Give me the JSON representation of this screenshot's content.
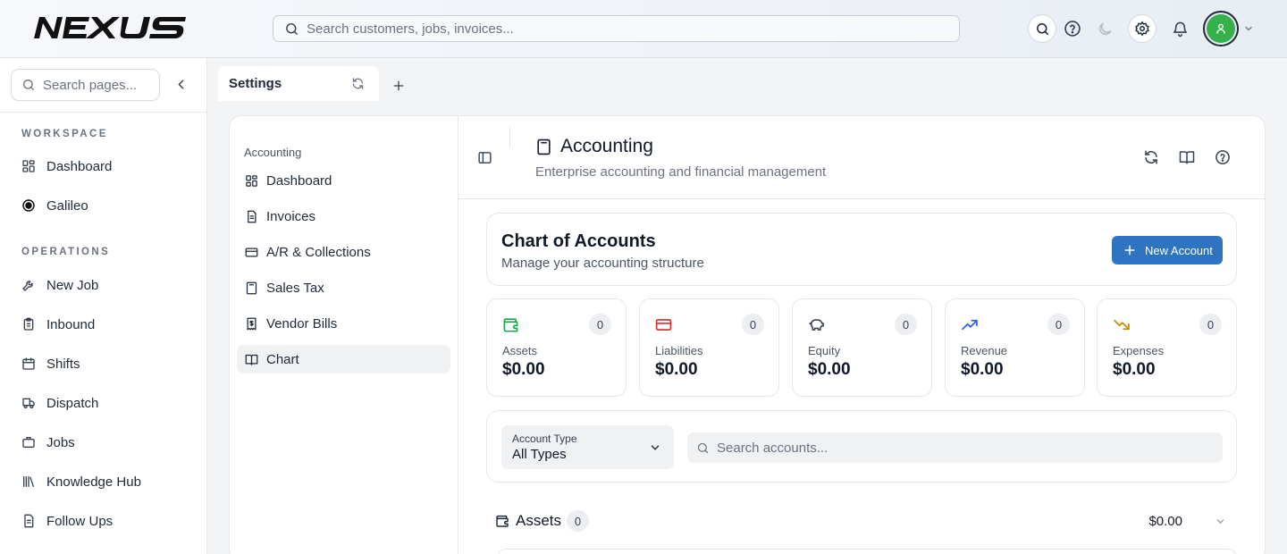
{
  "brand": {
    "logo_text": "NEXUS"
  },
  "top": {
    "search_placeholder": "Search customers, jobs, invoices..."
  },
  "sidebar": {
    "search_placeholder": "Search pages...",
    "sections": [
      {
        "title": "WORKSPACE",
        "items": [
          {
            "label": "Dashboard",
            "icon": "grid-icon"
          },
          {
            "label": "Galileo",
            "icon": "galileo-icon"
          }
        ]
      },
      {
        "title": "OPERATIONS",
        "items": [
          {
            "label": "New Job",
            "icon": "wrench-icon"
          },
          {
            "label": "Inbound",
            "icon": "clipboard-icon"
          },
          {
            "label": "Shifts",
            "icon": "calendar-icon"
          },
          {
            "label": "Dispatch",
            "icon": "truck-icon"
          },
          {
            "label": "Jobs",
            "icon": "briefcase-icon"
          },
          {
            "label": "Knowledge Hub",
            "icon": "library-icon"
          },
          {
            "label": "Follow Ups",
            "icon": "document-icon"
          }
        ]
      }
    ]
  },
  "tabs": [
    {
      "label": "Settings"
    }
  ],
  "accounting_menu": {
    "heading": "Accounting",
    "items": [
      {
        "label": "Dashboard",
        "icon": "grid-icon"
      },
      {
        "label": "Invoices",
        "icon": "document-icon"
      },
      {
        "label": "A/R & Collections",
        "icon": "credit-card-icon"
      },
      {
        "label": "Sales Tax",
        "icon": "calculator-icon"
      },
      {
        "label": "Vendor Bills",
        "icon": "receipt-icon"
      },
      {
        "label": "Chart",
        "icon": "book-icon",
        "active": true
      }
    ]
  },
  "module": {
    "title": "Accounting",
    "subtitle": "Enterprise accounting and financial management"
  },
  "chart_of_accounts": {
    "title": "Chart of Accounts",
    "subtitle": "Manage your accounting structure",
    "new_button": "New Account",
    "stats": [
      {
        "label": "Assets",
        "value": "$0.00",
        "count": "0",
        "icon": "wallet-icon",
        "color": "#16a34a"
      },
      {
        "label": "Liabilities",
        "value": "$0.00",
        "count": "0",
        "icon": "credit-card-icon",
        "color": "#dc2626"
      },
      {
        "label": "Equity",
        "value": "$0.00",
        "count": "0",
        "icon": "piggy-bank-icon",
        "color": "#374151"
      },
      {
        "label": "Revenue",
        "value": "$0.00",
        "count": "0",
        "icon": "trending-up-icon",
        "color": "#2563eb"
      },
      {
        "label": "Expenses",
        "value": "$0.00",
        "count": "0",
        "icon": "trending-down-icon",
        "color": "#ca8a04"
      }
    ],
    "filter": {
      "type_caption": "Account Type",
      "type_value": "All Types",
      "search_placeholder": "Search accounts..."
    },
    "groups": [
      {
        "name": "Assets",
        "count": "0",
        "total": "$0.00"
      }
    ]
  },
  "colors": {
    "accent": "#2f74c0",
    "avatar": "#35b04a"
  }
}
